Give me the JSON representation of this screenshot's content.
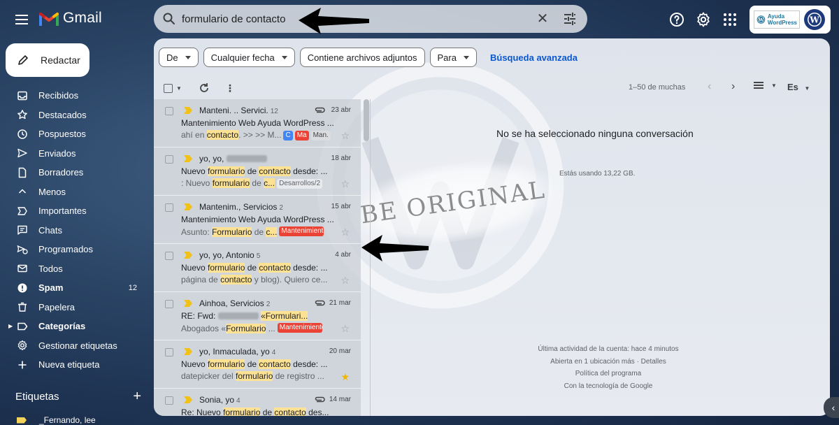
{
  "app": {
    "name": "Gmail"
  },
  "search": {
    "query": "formulario de contacto",
    "clear_label": "✕"
  },
  "header_icons": [
    "help-icon",
    "gear-icon",
    "apps-grid-icon"
  ],
  "account": {
    "badge_line1": "Ayuda",
    "badge_line2": "WordPress"
  },
  "compose": {
    "label": "Redactar"
  },
  "nav": [
    {
      "label": "Recibidos",
      "icon": "inbox-icon"
    },
    {
      "label": "Destacados",
      "icon": "star-icon"
    },
    {
      "label": "Pospuestos",
      "icon": "clock-icon"
    },
    {
      "label": "Enviados",
      "icon": "send-icon"
    },
    {
      "label": "Borradores",
      "icon": "draft-icon"
    },
    {
      "label": "Menos",
      "icon": "chevron-up-icon"
    },
    {
      "label": "Importantes",
      "icon": "important-icon"
    },
    {
      "label": "Chats",
      "icon": "chat-icon"
    },
    {
      "label": "Programados",
      "icon": "scheduled-send-icon"
    },
    {
      "label": "Todos",
      "icon": "all-mail-icon"
    },
    {
      "label": "Spam",
      "icon": "spam-icon",
      "count": "12",
      "bold": true
    },
    {
      "label": "Papelera",
      "icon": "trash-icon"
    },
    {
      "label": "Categorías",
      "icon": "label-icon",
      "bold": true
    },
    {
      "label": "Gestionar etiquetas",
      "icon": "settings-icon"
    },
    {
      "label": "Nueva etiqueta",
      "icon": "plus-icon"
    }
  ],
  "labels": {
    "heading": "Etiquetas",
    "add": "+",
    "first": "_Fernando, lee"
  },
  "filters": {
    "from": "De",
    "date": "Cualquier fecha",
    "attachments": "Contiene archivos adjuntos",
    "to": "Para",
    "advanced": "Búsqueda avanzada"
  },
  "toolbar": {
    "pager": "1–50 de muchas",
    "lang": "Es",
    "more": "⋮",
    "prev": "‹",
    "next": "›"
  },
  "mails": [
    {
      "sender": "Manteni. .. Servici.",
      "count": "12",
      "date": "23 abr",
      "attachment": true,
      "star": false,
      "subject": "Mantenimiento Web Ayuda WordPress ...",
      "snippet": [
        [
          "ahí en ",
          ""
        ],
        [
          "contacto",
          "hl"
        ],
        [
          ". >> >> M...",
          ""
        ]
      ],
      "tags": [
        [
          "C",
          "blue"
        ],
        [
          "Ma",
          "red"
        ],
        [
          "Man.",
          "gray"
        ]
      ]
    },
    {
      "sender": "yo, yo,",
      "count": "",
      "date": "18 abr",
      "attachment": false,
      "star": false,
      "blurred": true,
      "subject": "Nuevo formulario de contacto desde: ...",
      "snippet": [
        [
          ": Nuevo ",
          ""
        ],
        [
          "formulario",
          "hl"
        ],
        [
          " de ",
          ""
        ],
        [
          "c...",
          "hl"
        ]
      ],
      "tags": [
        [
          "Desarrollos/2",
          "ltgray"
        ]
      ]
    },
    {
      "sender": "Mantenim., Servicios",
      "count": "2",
      "date": "15 abr",
      "attachment": false,
      "star": false,
      "subject": "Mantenimiento Web Ayuda WordPress ...",
      "snippet": [
        [
          "Asunto: ",
          ""
        ],
        [
          "Formulario",
          "hl"
        ],
        [
          " de ",
          ""
        ],
        [
          "c...",
          "hl"
        ]
      ],
      "tags": [
        [
          "Mantenimiento",
          "redwide"
        ]
      ]
    },
    {
      "sender": "yo, yo, Antonio",
      "count": "5",
      "date": "4 abr",
      "attachment": false,
      "star": false,
      "subject": "Nuevo formulario de contacto desde: ...",
      "snippet": [
        [
          "página de ",
          ""
        ],
        [
          "contacto",
          "hl"
        ],
        [
          " y blog). Quiero ce...",
          ""
        ]
      ],
      "tags": []
    },
    {
      "sender": "Ainhoa, Servicios",
      "count": "2",
      "date": "21 mar",
      "attachment": true,
      "star": false,
      "blurredSubject": true,
      "subject": "RE: Fwd:",
      "subject_tail": "«Formulari...",
      "snippet": [
        [
          "Abogados «",
          ""
        ],
        [
          "Formulario",
          "hl"
        ],
        [
          " ...",
          ""
        ]
      ],
      "tags": [
        [
          "Mantenimiento",
          "redwide"
        ]
      ]
    },
    {
      "sender": "yo, Inmaculada, yo",
      "count": "4",
      "date": "20 mar",
      "attachment": false,
      "star": true,
      "subject": "Nuevo formulario de contacto desde: ...",
      "snippet": [
        [
          "datepicker del ",
          ""
        ],
        [
          "formulario",
          "hl"
        ],
        [
          " de registro ...",
          ""
        ]
      ],
      "tags": []
    },
    {
      "sender": "Sonia, yo",
      "count": "4",
      "date": "14 mar",
      "attachment": true,
      "star": false,
      "subject": "Re: Nuevo formulario de contacto des...",
      "snippet": [],
      "tags": []
    }
  ],
  "reading_pane": {
    "empty": "No se ha seleccionado ninguna conversación",
    "storage": "Estás usando 13,22 GB.",
    "footer": [
      "Última actividad de la cuenta: hace 4 minutos",
      "Abierta en 1 ubicación más · Detalles",
      "Política del programa",
      "Con la tecnología de Google"
    ]
  },
  "watermark_text": "BE ORIGINAL",
  "colors": {
    "highlight": "#fde293",
    "important": "#f2c118",
    "link": "#0b57d0",
    "tag_red": "#ea4335",
    "tag_blue": "#4285f4"
  }
}
